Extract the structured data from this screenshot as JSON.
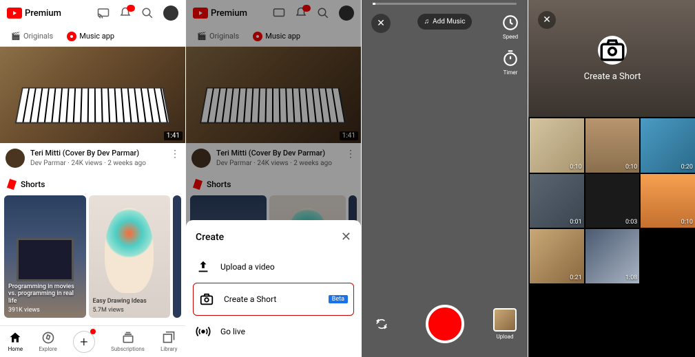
{
  "brand": "Premium",
  "tabs": {
    "originals": "Originals",
    "music": "Music app"
  },
  "video": {
    "title": "Teri Mitti (Cover By Dev Parmar)",
    "channel": "Dev Parmar",
    "views": "24K views",
    "age": "2 weeks ago",
    "duration": "1:41"
  },
  "shorts": {
    "header": "Shorts",
    "items": [
      {
        "title": "Programming in movies vs. programming in real life",
        "views": "391K views"
      },
      {
        "title": "Easy Drawing Ideas",
        "views": "5.7M views"
      }
    ]
  },
  "nav": {
    "home": "Home",
    "explore": "Explore",
    "subs": "Subscriptions",
    "library": "Library"
  },
  "sheet": {
    "title": "Create",
    "upload": "Upload a video",
    "short": "Create a Short",
    "live": "Go live",
    "beta": "Beta"
  },
  "camera": {
    "add_music": "Add Music",
    "speed": "Speed",
    "timer": "Timer",
    "upload": "Upload"
  },
  "gallery": {
    "title": "Create a Short",
    "durations": [
      "0:10",
      "0:10",
      "0:20",
      "0:01",
      "0:03",
      "0:10",
      "0:21",
      "1:08"
    ]
  }
}
